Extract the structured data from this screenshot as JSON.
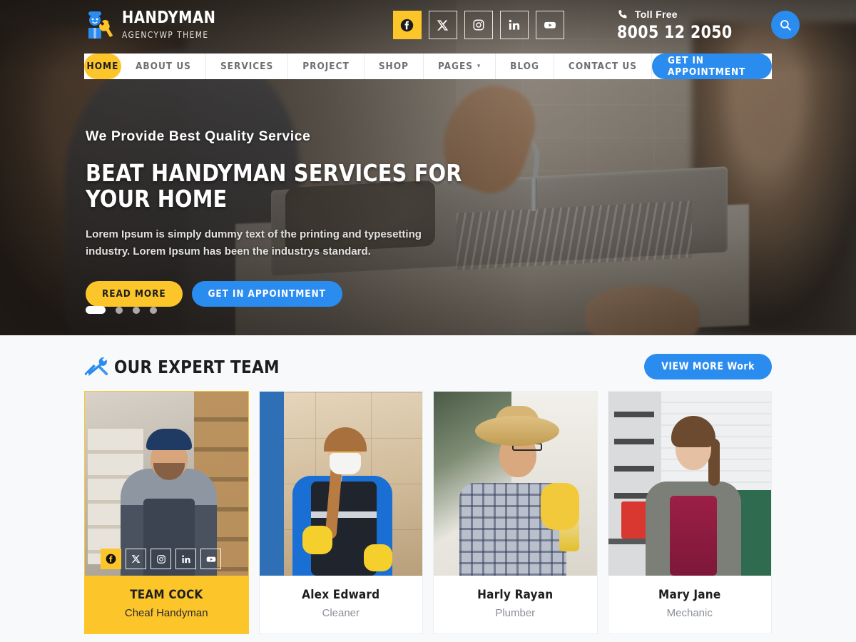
{
  "brand": {
    "title": "HANDYMAN",
    "subtitle": "AGENCYWP THEME",
    "logo_icon": "handyman-worker-wrench-icon"
  },
  "header": {
    "socials": [
      {
        "name": "facebook",
        "icon": "facebook-icon",
        "active": true
      },
      {
        "name": "x",
        "icon": "x-twitter-icon",
        "active": false
      },
      {
        "name": "instagram",
        "icon": "instagram-icon",
        "active": false
      },
      {
        "name": "linkedin",
        "icon": "linkedin-icon",
        "active": false
      },
      {
        "name": "youtube",
        "icon": "youtube-icon",
        "active": false
      }
    ],
    "contact": {
      "phone_icon": "phone-icon",
      "label": "Toll Free",
      "phone": "8005 12 2050"
    },
    "search_icon": "search-icon"
  },
  "nav": {
    "items": [
      {
        "label": "HOME",
        "active": true,
        "caret": false
      },
      {
        "label": "ABOUT US",
        "active": false,
        "caret": false
      },
      {
        "label": "SERVICES",
        "active": false,
        "caret": false
      },
      {
        "label": "PROJECT",
        "active": false,
        "caret": false
      },
      {
        "label": "SHOP",
        "active": false,
        "caret": false
      },
      {
        "label": "PAGES",
        "active": false,
        "caret": true
      },
      {
        "label": "BLOG",
        "active": false,
        "caret": false
      },
      {
        "label": "CONTACT US",
        "active": false,
        "caret": false
      }
    ],
    "caret_glyph": "⌄",
    "cta_label": "GET IN APPOINTMENT"
  },
  "hero": {
    "kicker": "We Provide Best Quality Service",
    "title": "BEAT HANDYMAN SERVICES FOR YOUR HOME",
    "description": "Lorem Ipsum is simply dummy text of the printing and typesetting industry. Lorem Ipsum has been the industrys standard.",
    "primary_button": "READ MORE",
    "secondary_button": "GET IN APPOINTMENT",
    "slides": 4,
    "active_slide": 1
  },
  "team": {
    "heading": "OUR EXPERT TEAM",
    "heading_icon": "screwdriver-wrench-icon",
    "view_more_label": "VIEW MORE Work",
    "members": [
      {
        "name": "TEAM COCK",
        "role": "Cheaf Handyman",
        "featured": true,
        "photo": "man-in-cap-and-overalls-workshop"
      },
      {
        "name": "Alex Edward",
        "role": "Cleaner",
        "featured": false,
        "photo": "woman-cleaner-mask-yellow-gloves"
      },
      {
        "name": "Harly Rayan",
        "role": "Plumber",
        "featured": false,
        "photo": "man-straw-hat-plaid-shirt-spray"
      },
      {
        "name": "Mary Jane",
        "role": "Mechanic",
        "featured": false,
        "photo": "woman-gray-jacket-magenta-top"
      }
    ],
    "card_socials": [
      {
        "name": "facebook",
        "icon": "facebook-icon",
        "active": true
      },
      {
        "name": "x",
        "icon": "x-twitter-icon",
        "active": false
      },
      {
        "name": "instagram",
        "icon": "instagram-icon",
        "active": false
      },
      {
        "name": "linkedin",
        "icon": "linkedin-icon",
        "active": false
      },
      {
        "name": "youtube",
        "icon": "youtube-icon",
        "active": false
      }
    ]
  },
  "colors": {
    "yellow": "#fcc62b",
    "blue": "#2b8cf0",
    "dark": "#1d1d1d",
    "section_bg": "#f7f9fb"
  }
}
